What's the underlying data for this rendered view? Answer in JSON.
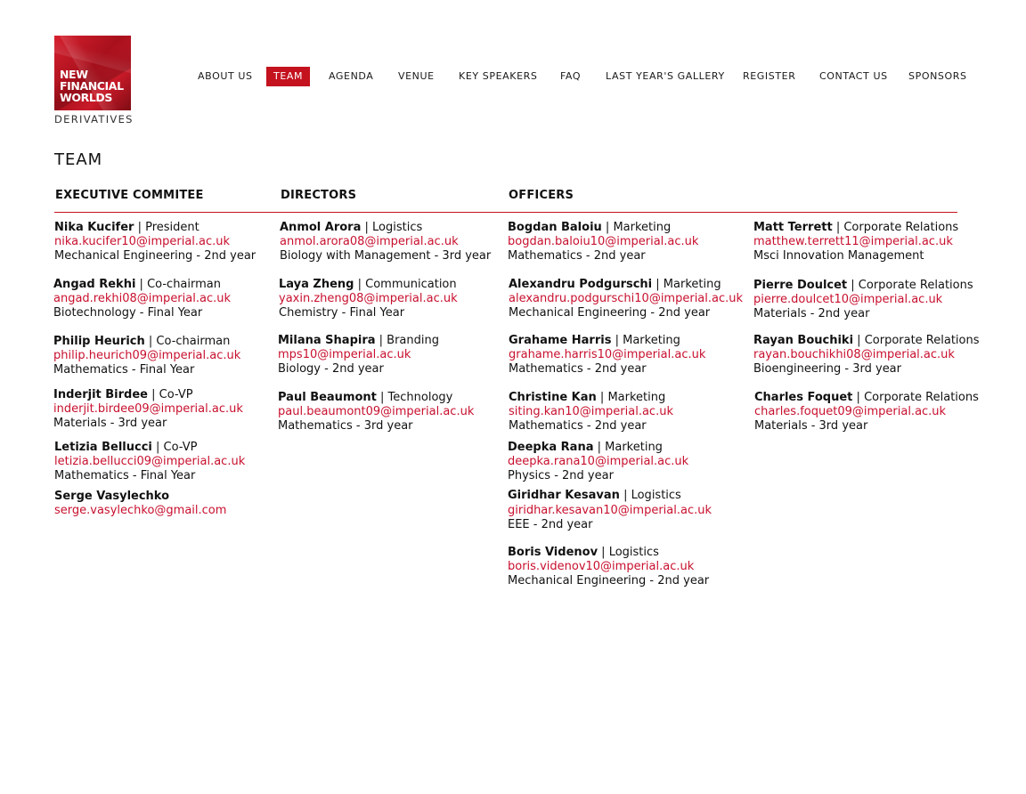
{
  "logo": {
    "line1": "NEW",
    "line2": "FINANCIAL",
    "line3": "WORLDS",
    "sub": "DERIVATIVES"
  },
  "nav": [
    {
      "label": "ABOUT US",
      "active": false
    },
    {
      "label": "TEAM",
      "active": true
    },
    {
      "label": "AGENDA",
      "active": false
    },
    {
      "label": "VENUE",
      "active": false
    },
    {
      "label": "KEY SPEAKERS",
      "active": false
    },
    {
      "label": "FAQ",
      "active": false
    },
    {
      "label": "LAST YEAR'S GALLERY",
      "active": false
    },
    {
      "label": "REGISTER",
      "active": false
    },
    {
      "label": "CONTACT US",
      "active": false
    },
    {
      "label": "SPONSORS",
      "active": false
    }
  ],
  "page_title": "TEAM",
  "sections": {
    "executive": "EXECUTIVE COMMITEE",
    "directors": "DIRECTORS",
    "officers": "OFFICERS"
  },
  "executive": [
    {
      "name": "Nika Kucifer",
      "role": "President",
      "email": "nika.kucifer10@imperial.ac.uk",
      "detail": "Mechanical Engineering - 2nd year"
    },
    {
      "name": "Angad Rekhi",
      "role": "Co-chairman",
      "email": "angad.rekhi08@imperial.ac.uk",
      "detail": "Biotechnology - Final Year"
    },
    {
      "name": "Philip Heurich",
      "role": "Co-chairman",
      "email": "philip.heurich09@imperial.ac.uk",
      "detail": "Mathematics - Final Year"
    },
    {
      "name": "Inderjit Birdee",
      "role": "Co-VP",
      "email": "inderjit.birdee09@imperial.ac.uk",
      "detail": "Materials - 3rd year"
    },
    {
      "name": "Letizia Bellucci",
      "role": "Co-VP",
      "email": "letizia.bellucci09@imperial.ac.uk",
      "detail": "Mathematics - Final Year"
    },
    {
      "name": "Serge Vasylechko",
      "role": "",
      "email": "serge.vasylechko@gmail.com",
      "detail": ""
    }
  ],
  "directors": [
    {
      "name": "Anmol Arora",
      "role": "Logistics",
      "email": "anmol.arora08@imperial.ac.uk",
      "detail": "Biology with Management - 3rd year"
    },
    {
      "name": "Laya Zheng",
      "role": "Communication",
      "email": "yaxin.zheng08@imperial.ac.uk",
      "detail": "Chemistry - Final Year"
    },
    {
      "name": "Milana Shapira",
      "role": "Branding",
      "email": "mps10@imperial.ac.uk",
      "detail": "Biology - 2nd year"
    },
    {
      "name": "Paul Beaumont",
      "role": "Technology",
      "email": "paul.beaumont09@imperial.ac.uk",
      "detail": "Mathematics - 3rd year"
    }
  ],
  "officers_a": [
    {
      "name": "Bogdan Baloiu",
      "role": "Marketing",
      "email": "bogdan.baloiu10@imperial.ac.uk",
      "detail": "Mathematics - 2nd year"
    },
    {
      "name": "Alexandru Podgurschi",
      "role": "Marketing",
      "email": "alexandru.podgurschi10@imperial.ac.uk",
      "detail": "Mechanical Engineering - 2nd year"
    },
    {
      "name": "Grahame Harris",
      "role": "Marketing",
      "email": "grahame.harris10@imperial.ac.uk",
      "detail": "Mathematics - 2nd year"
    },
    {
      "name": "Christine Kan",
      "role": "Marketing",
      "email": "siting.kan10@imperial.ac.uk",
      "detail": "Mathematics - 2nd year"
    },
    {
      "name": "Deepka Rana",
      "role": "Marketing",
      "email": "deepka.rana10@imperial.ac.uk",
      "detail": "Physics - 2nd year"
    },
    {
      "name": "Giridhar Kesavan",
      "role": "Logistics",
      "email": "giridhar.kesavan10@imperial.ac.uk",
      "detail": "EEE - 2nd year"
    },
    {
      "name": "Boris Videnov",
      "role": "Logistics",
      "email": "boris.videnov10@imperial.ac.uk",
      "detail": "Mechanical Engineering - 2nd year"
    }
  ],
  "officers_b": [
    {
      "name": "Matt Terrett",
      "role": "Corporate Relations",
      "email": "matthew.terrett11@imperial.ac.uk",
      "detail": "Msci Innovation Management"
    },
    {
      "name": "Pierre Doulcet",
      "role": "Corporate Relations",
      "email": "pierre.doulcet10@imperial.ac.uk",
      "detail": "Materials - 2nd year"
    },
    {
      "name": "Rayan Bouchiki",
      "role": "Corporate Relations",
      "email": "rayan.bouchikhi08@imperial.ac.uk",
      "detail": "Bioengineering - 3rd year"
    },
    {
      "name": "Charles Foquet",
      "role": "Corporate Relations",
      "email": "charles.foquet09@imperial.ac.uk",
      "detail": "Materials - 3rd year"
    }
  ],
  "colors": {
    "accent": "#c4121f",
    "link": "#c8102e",
    "text": "#111111"
  }
}
